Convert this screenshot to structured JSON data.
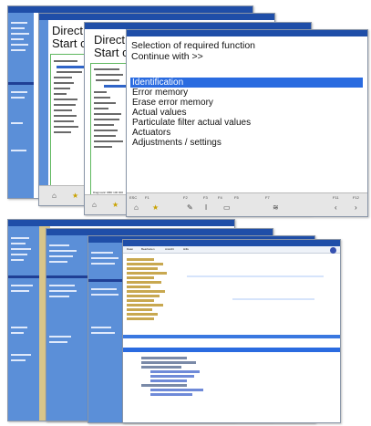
{
  "top_stack": {
    "window1": {
      "sidebar_selected": ""
    },
    "window2": {
      "header_line1": "Direct s",
      "header_line2": "Start co",
      "tree_items": [
        "Instrum...",
        "System overview",
        "Engine control",
        "ABS",
        "Airbag",
        "Gear control",
        "HVAC",
        "Central electr...",
        "Instrumentation",
        "Parking aid",
        "Lighting control",
        "Tires/steering",
        "Pos.control system",
        "Pictures info"
      ]
    },
    "window3": {
      "header_line1": "Direct s",
      "header_line2": "Start co",
      "tree_items": [
        "Instrum. OBD II",
        "System overvi...",
        "Engine control",
        "Engine manag...",
        "ABS",
        "Airbag",
        "Gear control",
        "HVAC",
        "Central electr...",
        "Instrumentation",
        "Parking aid",
        "Lighting control",
        "Tires/steering",
        "Pos.control system",
        "Pictures info"
      ],
      "footer_text": "Diagnostic OBD 100 000"
    },
    "window4": {
      "heading": "Selection of required function",
      "continue_prompt": "Continue with >>",
      "menu": [
        {
          "label": "Identification",
          "selected": true
        },
        {
          "label": "Error memory",
          "selected": false
        },
        {
          "label": "Erase error memory",
          "selected": false
        },
        {
          "label": "Actual values",
          "selected": false
        },
        {
          "label": "Particulate filter actual values",
          "selected": false
        },
        {
          "label": "Actuators",
          "selected": false
        },
        {
          "label": "Adjustments / settings",
          "selected": false
        }
      ],
      "function_keys": [
        "ESC",
        "F1",
        "F2",
        "F3",
        "F4",
        "F5",
        "F6",
        "F7",
        "F8",
        "F9",
        "F10",
        "F11",
        "F12"
      ]
    }
  },
  "bottom_stack": {
    "front_window": {
      "toolbar_items": [
        "Datei",
        "Bearbeiten",
        "Ansicht",
        "Hilfe"
      ]
    }
  },
  "colors": {
    "sidebar_blue": "#5b8fd8",
    "title_blue": "#1f4ea8",
    "selection_blue": "#2a6be0",
    "tree_border_green": "#5fb85f"
  }
}
